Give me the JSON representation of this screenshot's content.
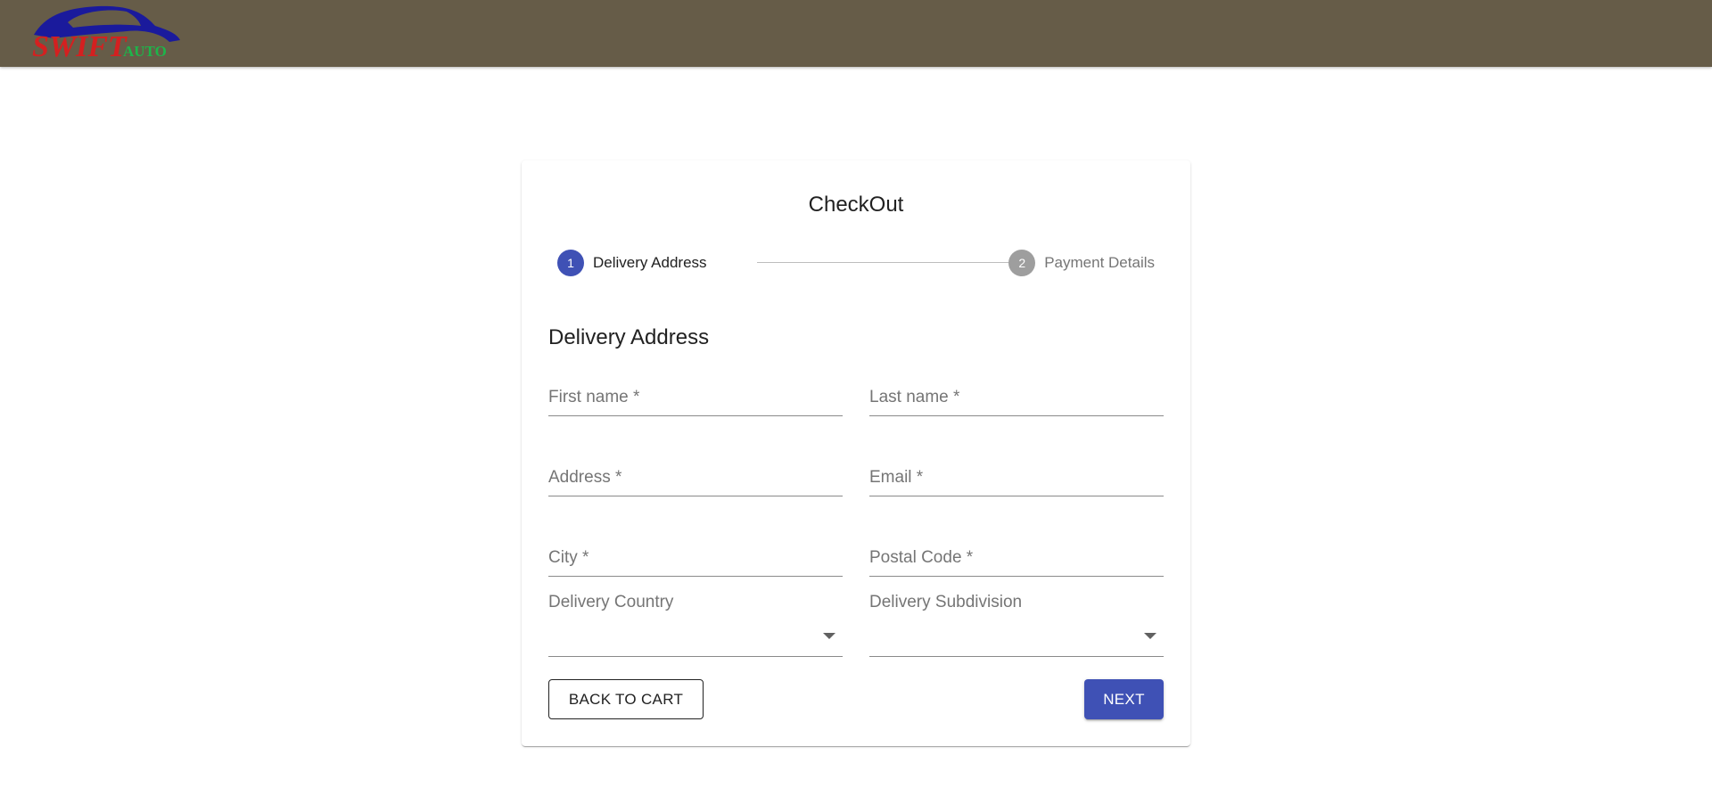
{
  "header": {
    "logo_text_primary": "SWIFT",
    "logo_text_secondary": "AUTO",
    "background_color": "#665c48"
  },
  "checkout": {
    "title": "CheckOut",
    "steps": [
      {
        "number": "1",
        "label": "Delivery Address",
        "active": true
      },
      {
        "number": "2",
        "label": "Payment Details",
        "active": false
      }
    ],
    "section_title": "Delivery Address",
    "fields": {
      "first_name": {
        "label": "First name *",
        "value": ""
      },
      "last_name": {
        "label": "Last name *",
        "value": ""
      },
      "address": {
        "label": "Address *",
        "value": ""
      },
      "email": {
        "label": "Email *",
        "value": ""
      },
      "city": {
        "label": "City *",
        "value": ""
      },
      "postal_code": {
        "label": "Postal Code *",
        "value": ""
      },
      "delivery_country": {
        "label": "Delivery Country",
        "value": ""
      },
      "delivery_subdivision": {
        "label": "Delivery Subdivision",
        "value": ""
      }
    },
    "buttons": {
      "back": "BACK TO CART",
      "next": "NEXT"
    },
    "accent_color": "#3f51b5",
    "inactive_step_color": "#9e9e9e"
  }
}
